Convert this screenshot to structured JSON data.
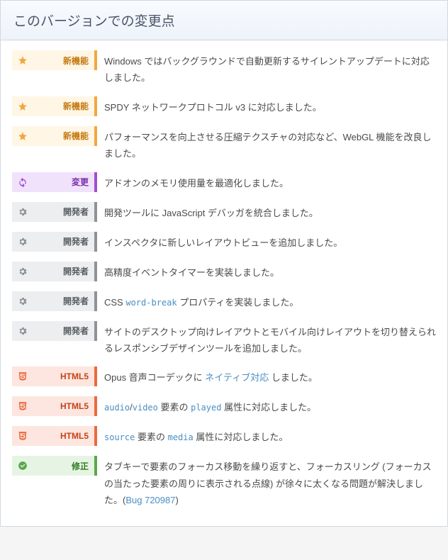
{
  "heading": "このバージョンでの変更点",
  "tag_labels": {
    "new": "新機能",
    "changed": "変更",
    "dev": "開発者",
    "html5": "HTML5",
    "fixed": "修正"
  },
  "items": [
    {
      "tag": "new",
      "parts": [
        {
          "type": "text",
          "value": "Windows ではバックグラウンドで自動更新するサイレントアップデートに対応しました。"
        }
      ]
    },
    {
      "tag": "new",
      "parts": [
        {
          "type": "text",
          "value": "SPDY ネットワークプロトコル v3 に対応しました。"
        }
      ]
    },
    {
      "tag": "new",
      "parts": [
        {
          "type": "text",
          "value": "パフォーマンスを向上させる圧縮テクスチャの対応など、WebGL 機能を改良しました。"
        }
      ]
    },
    {
      "tag": "changed",
      "parts": [
        {
          "type": "text",
          "value": "アドオンのメモリ使用量を最適化しました。"
        }
      ]
    },
    {
      "tag": "dev",
      "parts": [
        {
          "type": "text",
          "value": "開発ツールに JavaScript デバッガを統合しました。"
        }
      ]
    },
    {
      "tag": "dev",
      "parts": [
        {
          "type": "text",
          "value": "インスペクタに新しいレイアウトビューを追加しました。"
        }
      ]
    },
    {
      "tag": "dev",
      "parts": [
        {
          "type": "text",
          "value": "高精度イベントタイマーを実装しました。"
        }
      ]
    },
    {
      "tag": "dev",
      "parts": [
        {
          "type": "text",
          "value": "CSS "
        },
        {
          "type": "code",
          "value": "word-break"
        },
        {
          "type": "text",
          "value": " プロパティを実装しました。"
        }
      ]
    },
    {
      "tag": "dev",
      "parts": [
        {
          "type": "text",
          "value": "サイトのデスクトップ向けレイアウトとモバイル向けレイアウトを切り替えられるレスポンシブデザインツールを追加しました。"
        }
      ]
    },
    {
      "tag": "html5",
      "parts": [
        {
          "type": "text",
          "value": "Opus 音声コーデックに "
        },
        {
          "type": "link",
          "value": "ネイティブ対応"
        },
        {
          "type": "text",
          "value": " しました。"
        }
      ]
    },
    {
      "tag": "html5",
      "parts": [
        {
          "type": "code",
          "value": "audio"
        },
        {
          "type": "text",
          "value": "/"
        },
        {
          "type": "code",
          "value": "video"
        },
        {
          "type": "text",
          "value": " 要素の "
        },
        {
          "type": "code",
          "value": "played"
        },
        {
          "type": "text",
          "value": " 属性に対応しました。"
        }
      ]
    },
    {
      "tag": "html5",
      "parts": [
        {
          "type": "code",
          "value": "source"
        },
        {
          "type": "text",
          "value": " 要素の "
        },
        {
          "type": "code",
          "value": "media"
        },
        {
          "type": "text",
          "value": " 属性に対応しました。"
        }
      ]
    },
    {
      "tag": "fixed",
      "parts": [
        {
          "type": "text",
          "value": "タブキーで要素のフォーカス移動を繰り返すと、フォーカスリング (フォーカスの当たった要素の周りに表示される点線) が徐々に太くなる問題が解決しました。("
        },
        {
          "type": "link",
          "value": "Bug 720987"
        },
        {
          "type": "text",
          "value": ")"
        }
      ]
    }
  ]
}
